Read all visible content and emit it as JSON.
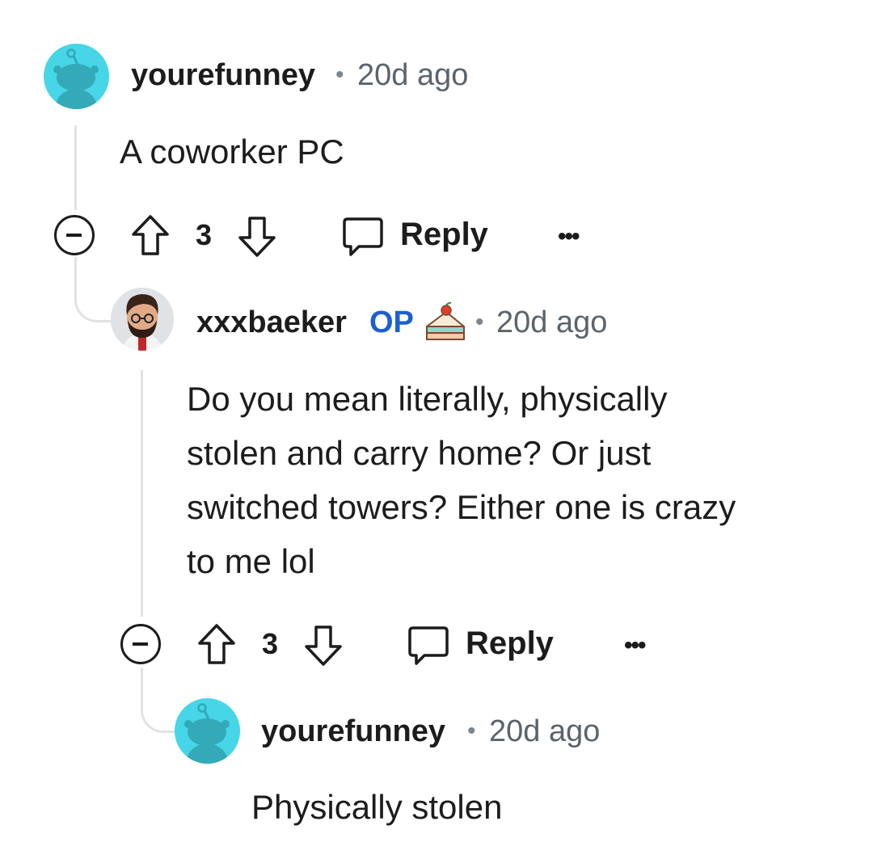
{
  "comments": [
    {
      "username": "yourefunney",
      "separator": "•",
      "time": "20d ago",
      "body": "A coworker PC",
      "votes": "3",
      "reply_label": "Reply",
      "more_label": "•••"
    },
    {
      "username": "xxxbaeker",
      "op_badge": "OP",
      "separator": "•",
      "time": "20d ago",
      "body_lines": [
        "Do you mean literally, physically",
        "stolen and carry home? Or just",
        "switched towers? Either one is crazy",
        "to me lol"
      ],
      "votes": "3",
      "reply_label": "Reply",
      "more_label": "•••"
    },
    {
      "username": "yourefunney",
      "separator": "•",
      "time": "20d ago",
      "body": "Physically stolen"
    }
  ],
  "colors": {
    "avatar_teal": "#46d6e8",
    "op_blue": "#1d5fd0",
    "thread_line": "#e0e2e4"
  }
}
